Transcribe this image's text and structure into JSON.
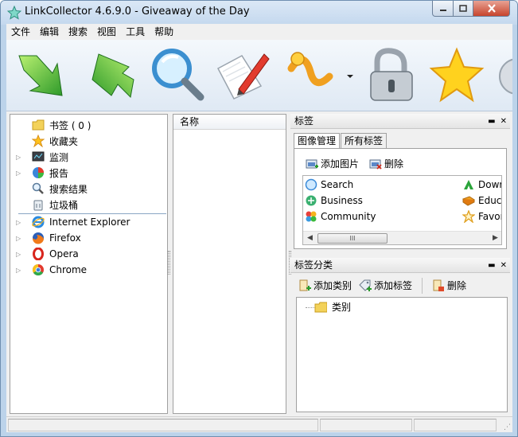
{
  "window": {
    "title": "LinkCollector 4.6.9.0 - Giveaway of the Day",
    "accent": "#bcd3ea"
  },
  "menu": [
    "文件",
    "编辑",
    "搜索",
    "视图",
    "工具",
    "帮助"
  ],
  "toolbar": {
    "buttons": [
      {
        "icon": "green-arrow-down-icon"
      },
      {
        "icon": "green-arrow-up-icon"
      },
      {
        "icon": "magnifier-icon"
      },
      {
        "icon": "pen-paper-icon"
      },
      {
        "icon": "tag-swirl-icon",
        "has_dropdown": true
      },
      {
        "icon": "padlock-icon"
      },
      {
        "icon": "star-icon"
      }
    ]
  },
  "left_tree": {
    "items": [
      {
        "label": "书签 ( 0 )",
        "icon": "folder-icon",
        "expandable": false
      },
      {
        "label": "收藏夹",
        "icon": "star-icon",
        "expandable": false
      },
      {
        "label": "监测",
        "icon": "monitor-icon",
        "expandable": true
      },
      {
        "label": "报告",
        "icon": "pie-chart-icon",
        "expandable": true
      },
      {
        "label": "搜索结果",
        "icon": "search-icon",
        "expandable": false
      },
      {
        "label": "垃圾桶",
        "icon": "trash-icon",
        "expandable": false
      }
    ],
    "browsers": [
      {
        "label": "Internet Explorer",
        "icon": "ie-icon"
      },
      {
        "label": "Firefox",
        "icon": "firefox-icon"
      },
      {
        "label": "Opera",
        "icon": "opera-icon"
      },
      {
        "label": "Chrome",
        "icon": "chrome-icon"
      }
    ]
  },
  "middle": {
    "column_header": "名称"
  },
  "tags_panel": {
    "title": "标签",
    "tabs": [
      "图像管理",
      "所有标签"
    ],
    "active_tab": 0,
    "add_image_label": "添加图片",
    "delete_label": "删除",
    "list_items": [
      {
        "label": "Search",
        "icon": "search-icon"
      },
      {
        "label": "Business",
        "icon": "business-icon"
      },
      {
        "label": "Community",
        "icon": "community-icon"
      },
      {
        "label": "Dowr",
        "icon": "download-icon"
      },
      {
        "label": "Educa",
        "icon": "book-icon"
      },
      {
        "label": "Favor",
        "icon": "star-outline-icon"
      }
    ],
    "scroll_grip": "III"
  },
  "tag_category_panel": {
    "title": "标签分类",
    "add_category_label": "添加类别",
    "add_tag_label": "添加标签",
    "delete_label": "删除",
    "tree_root": "类别"
  }
}
